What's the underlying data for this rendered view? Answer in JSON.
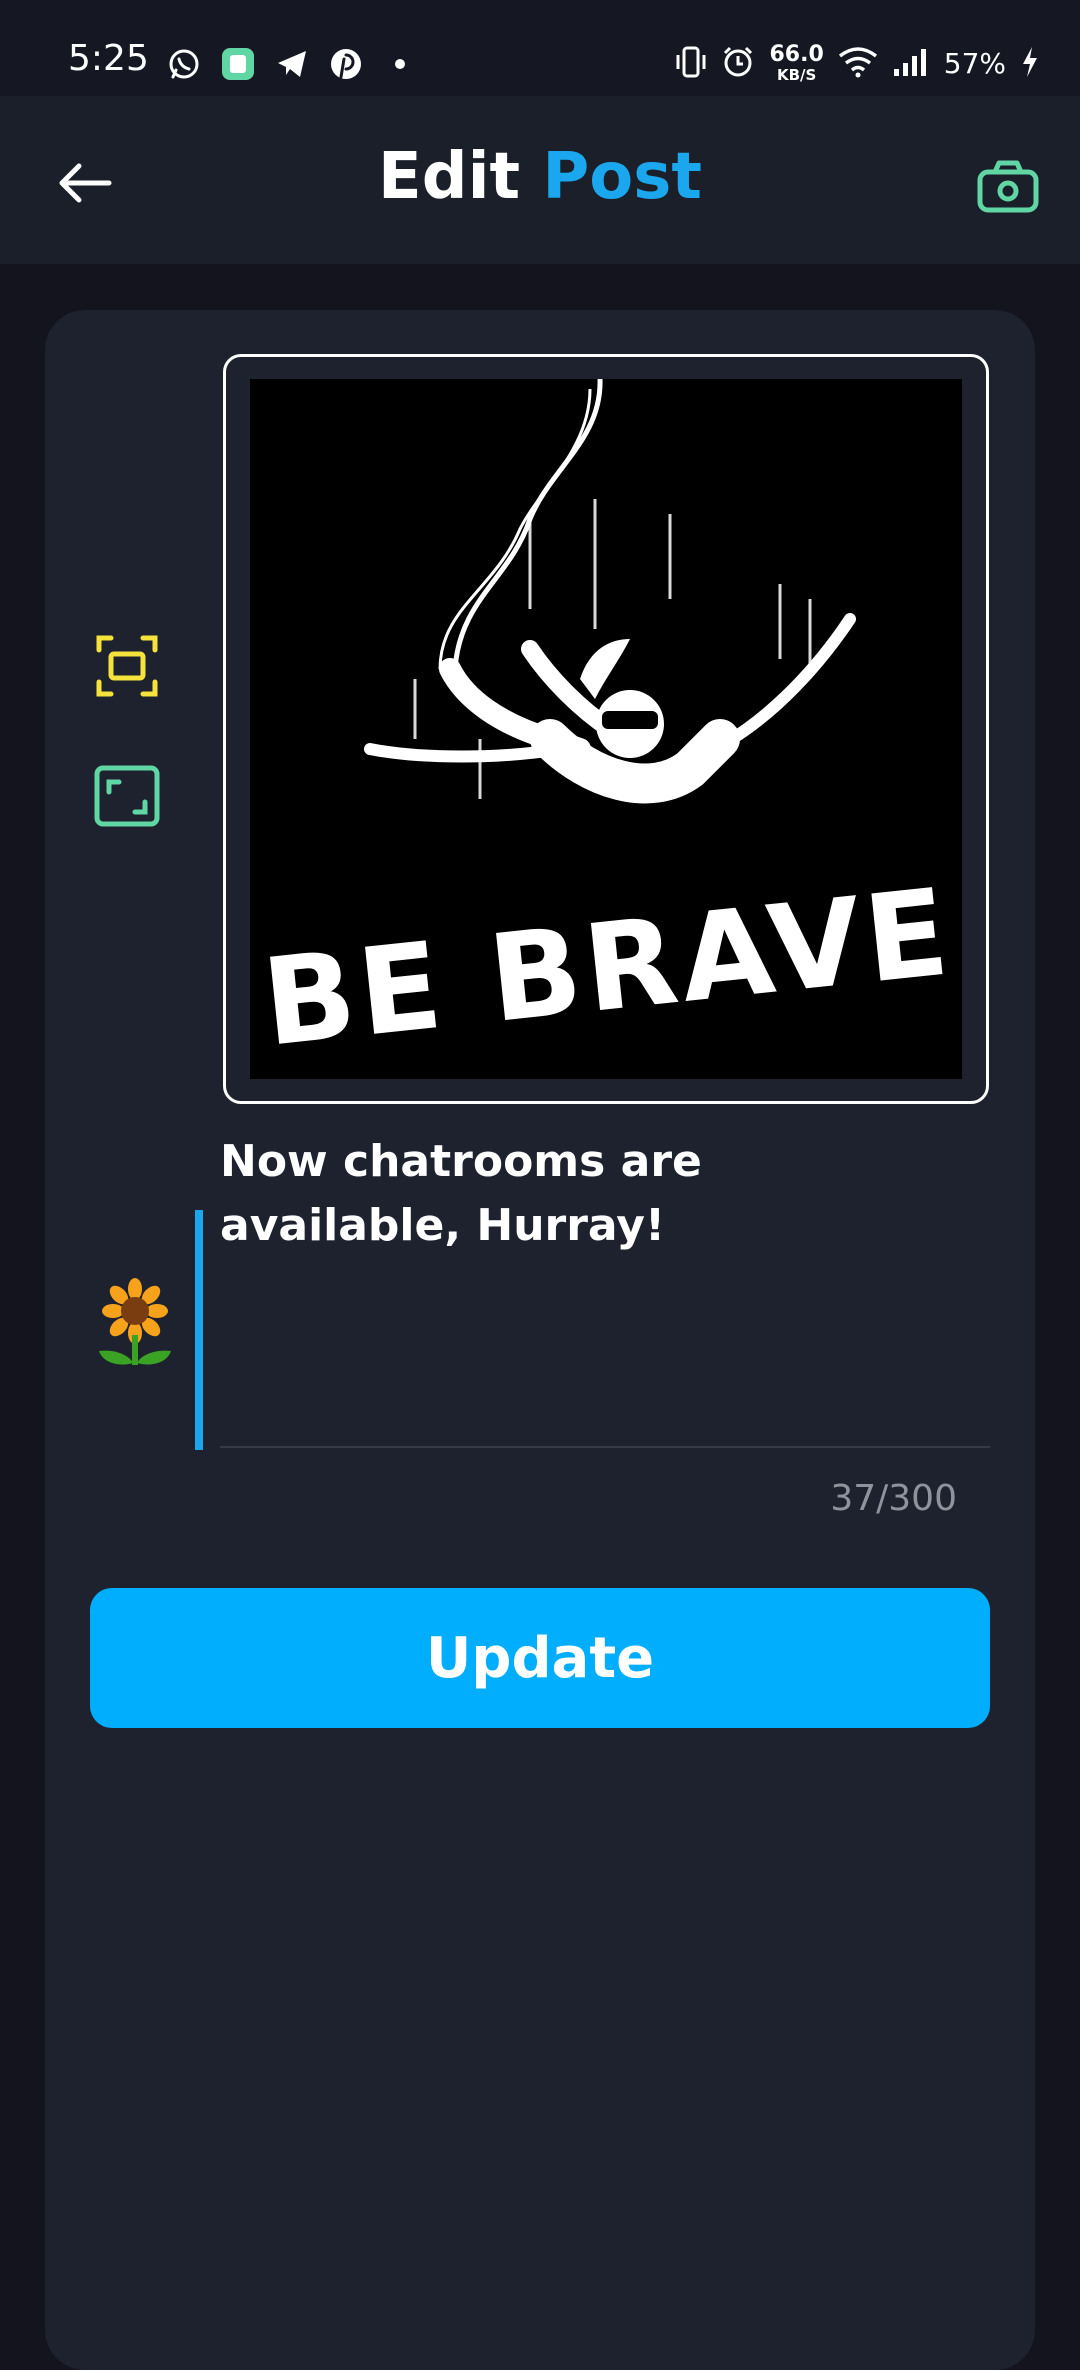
{
  "status_bar": {
    "time": "5:25",
    "net_speed_value": "66.0",
    "net_speed_unit": "KB/S",
    "battery_percent": "57%",
    "notification_icons": [
      "whatsapp-icon",
      "app-icon",
      "telegram-icon",
      "pinterest-icon",
      "dot-icon"
    ],
    "system_icons": [
      "vibrate-icon",
      "alarm-icon",
      "wifi-icon",
      "signal-icon",
      "charging-icon"
    ]
  },
  "header": {
    "title_part1": "Edit ",
    "title_part2": "Post",
    "back_icon": "arrow-left-icon",
    "camera_icon": "camera-icon"
  },
  "editor": {
    "crop_tool_icon": "crop-icon",
    "fit_tool_icon": "aspect-ratio-icon",
    "image_text": "BE BRAVE",
    "caption": "Now chatrooms are available, Hurray!",
    "emoji": "🌻",
    "counter": "37/300"
  },
  "actions": {
    "update_label": "Update"
  },
  "colors": {
    "accent_blue": "#1aa7ee",
    "button_blue": "#00aefd",
    "icon_yellow": "#f5e23a",
    "icon_green": "#5fd6a4",
    "card_bg": "#1e222e",
    "header_bg": "#1b1f2a"
  }
}
